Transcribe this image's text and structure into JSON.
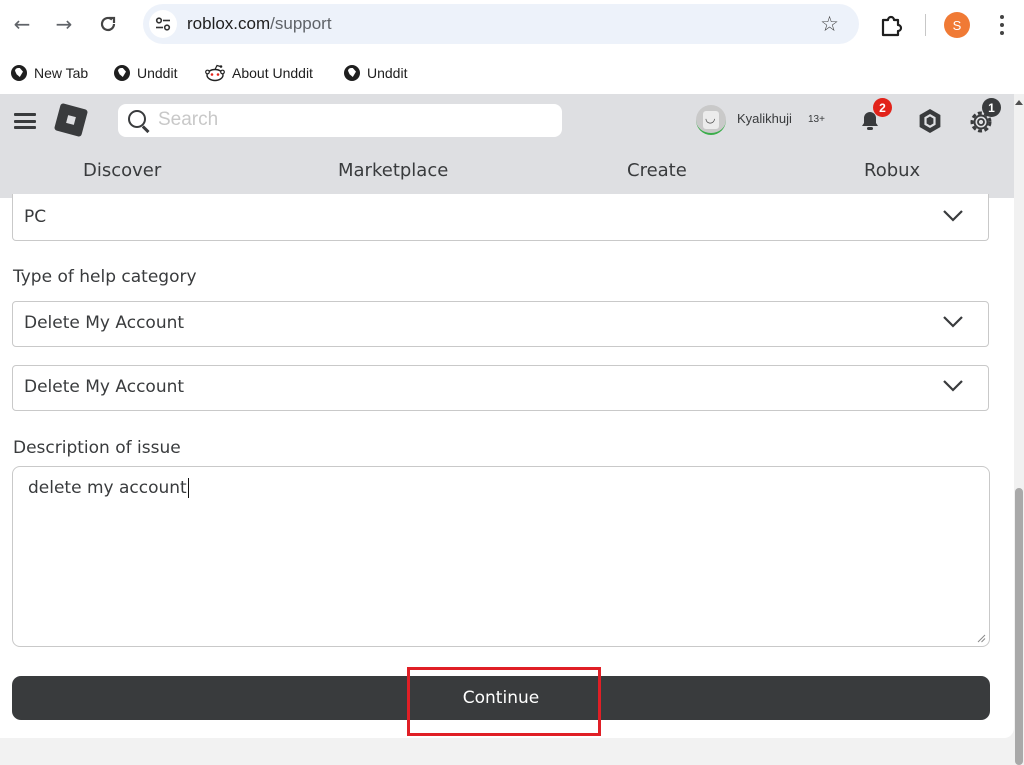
{
  "browser": {
    "url_host": "roblox.com",
    "url_path": "/support",
    "profile_initial": "S",
    "bookmarks": [
      {
        "label": "New Tab",
        "icon": "globe-icon"
      },
      {
        "label": "Unddit",
        "icon": "globe-icon"
      },
      {
        "label": "About Unddit",
        "icon": "reddit-alien-icon"
      },
      {
        "label": "Unddit",
        "icon": "globe-icon"
      }
    ]
  },
  "header": {
    "search_placeholder": "Search",
    "username": "Kyalikhuji",
    "age_label": "13+",
    "notification_count": "2",
    "settings_count": "1",
    "nav": [
      "Discover",
      "Marketplace",
      "Create",
      "Robux"
    ]
  },
  "form": {
    "device_value": "PC",
    "category_label": "Type of help category",
    "category_value": "Delete My Account",
    "subcategory_value": "Delete My Account",
    "description_label": "Description of issue",
    "description_value": "delete my account",
    "continue_label": "Continue"
  },
  "colors": {
    "header_bg": "#dedfe2",
    "button_bg": "#393b3d",
    "highlight": "#e01f26",
    "badge_red": "#e2231a",
    "profile": "#f07a35"
  }
}
